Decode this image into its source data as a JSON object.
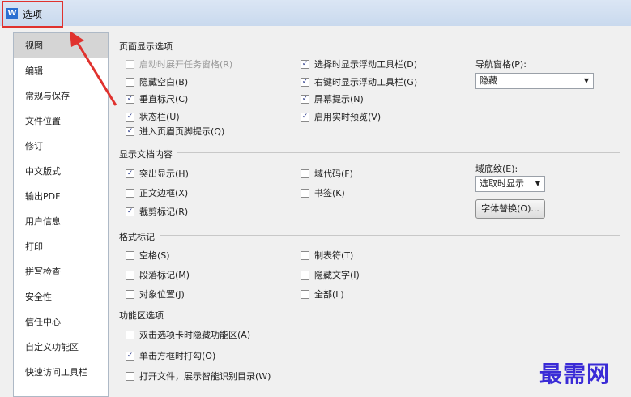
{
  "window": {
    "title": "选项",
    "icon_letter": "W"
  },
  "sidebar": {
    "items": [
      {
        "label": "视图",
        "selected": true
      },
      {
        "label": "编辑"
      },
      {
        "label": "常规与保存"
      },
      {
        "label": "文件位置"
      },
      {
        "label": "修订"
      },
      {
        "label": "中文版式"
      },
      {
        "label": "输出PDF"
      },
      {
        "label": "用户信息"
      },
      {
        "label": "打印"
      },
      {
        "label": "拼写检查"
      },
      {
        "label": "安全性"
      },
      {
        "label": "信任中心"
      },
      {
        "label": "自定义功能区"
      },
      {
        "label": "快速访问工具栏"
      }
    ]
  },
  "page_display": {
    "title": "页面显示选项",
    "options": [
      {
        "label": "启动时展开任务窗格(R)",
        "checked": false,
        "disabled": true
      },
      {
        "label": "隐藏空白(B)",
        "checked": false
      },
      {
        "label": "垂直标尺(C)",
        "checked": true
      },
      {
        "label": "状态栏(U)",
        "checked": true
      },
      {
        "label": "进入页眉页脚提示(Q)",
        "checked": true
      },
      {
        "label": "选择时显示浮动工具栏(D)",
        "checked": true
      },
      {
        "label": "右键时显示浮动工具栏(G)",
        "checked": true
      },
      {
        "label": "屏幕提示(N)",
        "checked": true
      },
      {
        "label": "启用实时预览(V)",
        "checked": true
      }
    ],
    "nav_label": "导航窗格(P):",
    "nav_value": "隐藏"
  },
  "doc_content": {
    "title": "显示文档内容",
    "options": [
      {
        "label": "突出显示(H)",
        "checked": true
      },
      {
        "label": "正文边框(X)",
        "checked": false
      },
      {
        "label": "裁剪标记(R)",
        "checked": true
      },
      {
        "label": "域代码(F)",
        "checked": false
      },
      {
        "label": "书签(K)",
        "checked": false
      }
    ],
    "shading_label": "域底纹(E):",
    "shading_value": "选取时显示",
    "font_sub_button": "字体替换(O)..."
  },
  "format_marks": {
    "title": "格式标记",
    "options": [
      {
        "label": "空格(S)",
        "checked": false
      },
      {
        "label": "段落标记(M)",
        "checked": false
      },
      {
        "label": "对象位置(J)",
        "checked": false
      },
      {
        "label": "制表符(T)",
        "checked": false
      },
      {
        "label": "隐藏文字(I)",
        "checked": false
      },
      {
        "label": "全部(L)",
        "checked": false
      }
    ]
  },
  "ribbon": {
    "title": "功能区选项",
    "options": [
      {
        "label": "双击选项卡时隐藏功能区(A)",
        "checked": false
      },
      {
        "label": "单击方框时打勾(O)",
        "checked": true
      },
      {
        "label": "打开文件，展示智能识别目录(W)",
        "checked": false
      }
    ]
  },
  "watermark": "最需网",
  "colors": {
    "highlight": "#e0322e",
    "watermark": "#3a2bd6"
  }
}
